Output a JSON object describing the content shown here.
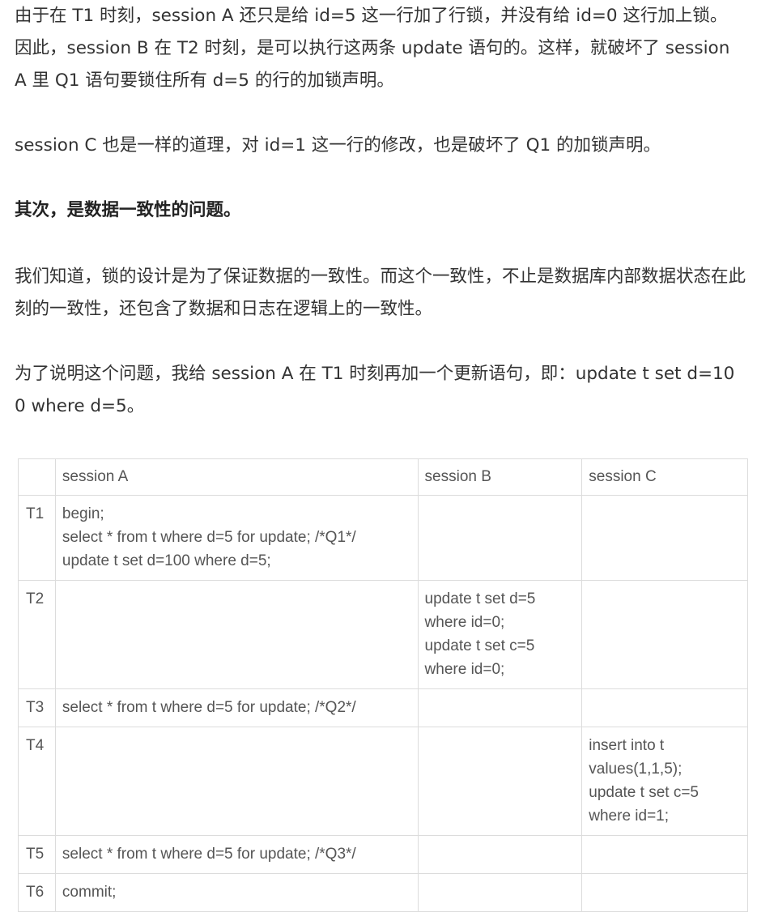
{
  "paragraphs": {
    "p1": "由于在 T1 时刻，session A 还只是给 id=5 这一行加了行锁，并没有给 id=0 这行加上锁。因此，session B 在 T2 时刻，是可以执行这两条 update 语句的。这样，就破坏了 session A 里 Q1 语句要锁住所有 d=5 的行的加锁声明。",
    "p2": "session C 也是一样的道理，对 id=1 这一行的修改，也是破坏了 Q1 的加锁声明。",
    "p3": "其次，是数据一致性的问题。",
    "p4": "我们知道，锁的设计是为了保证数据的一致性。而这个一致性，不止是数据库内部数据状态在此刻的一致性，还包含了数据和日志在逻辑上的一致性。",
    "p5": "为了说明这个问题，我给 session A 在 T1 时刻再加一个更新语句，即：update t set d=100 where d=5。"
  },
  "table": {
    "headers": [
      "",
      "session A",
      "session B",
      "session C"
    ],
    "rows": [
      {
        "label": "T1",
        "session_a": [
          "begin;",
          "select * from t where d=5 for update; /*Q1*/",
          "update t set d=100 where d=5;"
        ],
        "session_b": [],
        "session_c": []
      },
      {
        "label": "T2",
        "session_a": [],
        "session_b": [
          "update t set d=5",
          "where id=0;",
          "update t set c=5",
          "where id=0;"
        ],
        "session_c": []
      },
      {
        "label": "T3",
        "session_a": [
          "select * from t where d=5 for update; /*Q2*/"
        ],
        "session_b": [],
        "session_c": []
      },
      {
        "label": "T4",
        "session_a": [],
        "session_b": [],
        "session_c": [
          "insert into t",
          "values(1,1,5);",
          "update t set c=5",
          "where id=1;"
        ]
      },
      {
        "label": "T5",
        "session_a": [
          "select * from t where d=5 for update; /*Q3*/"
        ],
        "session_b": [],
        "session_c": []
      },
      {
        "label": "T6",
        "session_a": [
          "commit;"
        ],
        "session_b": [],
        "session_c": []
      }
    ]
  }
}
